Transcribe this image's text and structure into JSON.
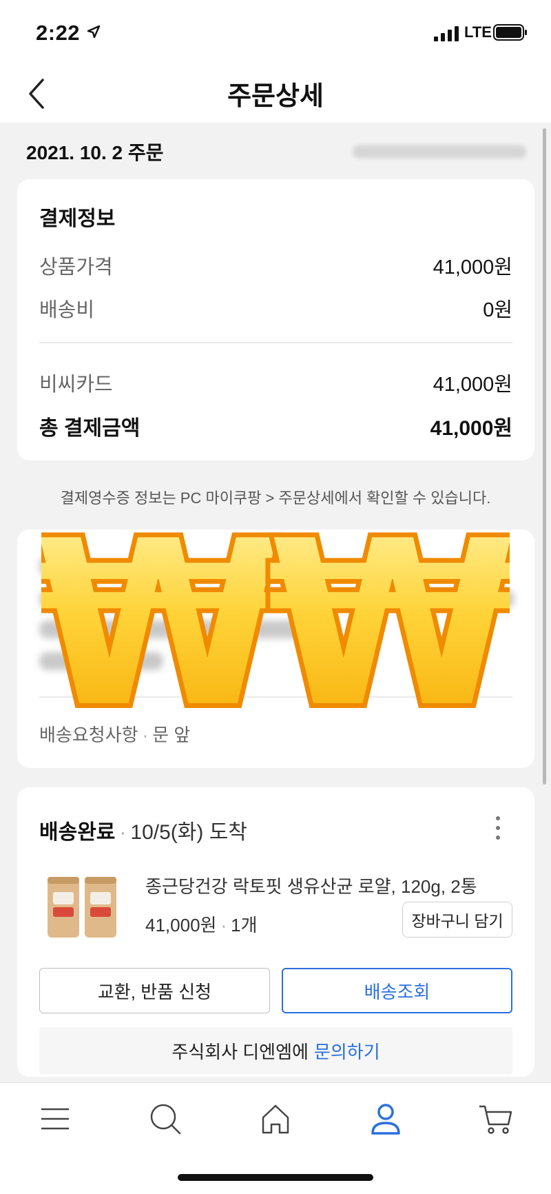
{
  "status_bar": {
    "time": "2:22",
    "network": "LTE",
    "icons": [
      "location-arrow-icon",
      "signal-icon",
      "battery-icon"
    ]
  },
  "header": {
    "title": "주문상세",
    "back_icon": "chevron-left-icon"
  },
  "order": {
    "date_label": "2021. 10. 2 주문"
  },
  "payment": {
    "title": "결제정보",
    "rows": [
      {
        "label": "상품가격",
        "value": "41,000원"
      },
      {
        "label": "배송비",
        "value": "0원"
      }
    ],
    "card_row": {
      "label": "비씨카드",
      "value": "41,000원"
    },
    "total": {
      "label": "총 결제금액",
      "value": "41,000원"
    }
  },
  "receipt_note": "결제영수증 정보는 PC 마이쿠팡 > 주문상세에서 확인할 수 있습니다.",
  "shipping": {
    "request_label": "배송요청사항",
    "request_value": "문 앞"
  },
  "delivery": {
    "status": "배송완료",
    "arrival": "10/5(화) 도착",
    "product": {
      "name": "종근당건강 락토핏 생유산균 로얄, 120g, 2통",
      "price": "41,000원",
      "quantity": "1개"
    },
    "cart_button": "장바구니 담기",
    "return_button": "교환, 반품 신청",
    "track_button": "배송조회",
    "seller": "주식회사 디엔엠에",
    "inquiry_link": "문의하기"
  },
  "tab_bar": {
    "tabs": [
      "menu-icon",
      "search-icon",
      "home-icon",
      "my-coupang-icon",
      "cart-icon"
    ],
    "active_tab": "my-coupang-icon",
    "active_color": "#2a6fe0"
  },
  "colors": {
    "accent": "#2a6fe0",
    "background": "#f2f2f2"
  }
}
